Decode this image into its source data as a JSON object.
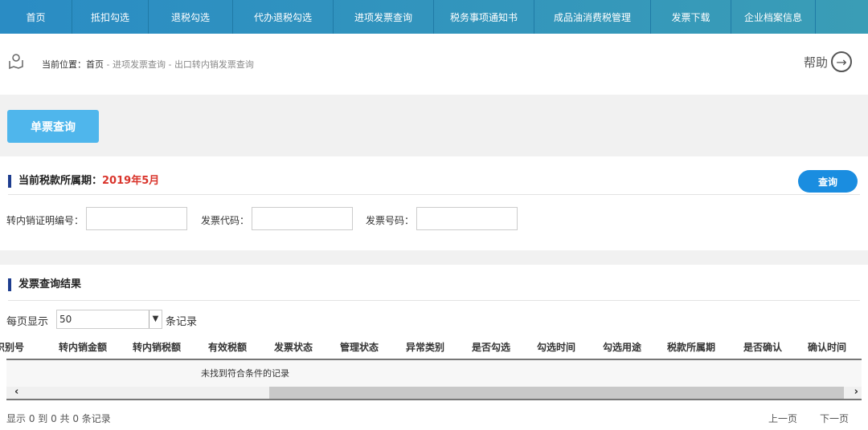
{
  "nav": [
    "首页",
    "抵扣勾选",
    "退税勾选",
    "代办退税勾选",
    "进项发票查询",
    "税务事项通知书",
    "成品油消费税管理",
    "发票下载",
    "企业档案信息"
  ],
  "breadcrumb": {
    "prefix": "当前位置：",
    "home": "首页",
    "sep1": " - ",
    "level1": "进项发票查询",
    "sep2": " - ",
    "current": "出口转内销发票查询"
  },
  "help": {
    "label": "帮助",
    "icon": "→"
  },
  "single_query_button": "单票查询",
  "period": {
    "label": "当前税款所属期：",
    "value": "2019年5月"
  },
  "query_button": "查询",
  "fields": {
    "cert_no": "转内销证明编号：",
    "invoice_code": "发票代码：",
    "invoice_number": "发票号码："
  },
  "results": {
    "title": "发票查询结果",
    "page_size_prefix": "每页显示",
    "page_size": "50",
    "page_size_suffix": "条记录",
    "columns": [
      "识别号",
      "转内销金额",
      "转内销税额",
      "有效税额",
      "发票状态",
      "管理状态",
      "异常类别",
      "是否勾选",
      "勾选时间",
      "勾选用途",
      "税款所属期",
      "是否确认",
      "确认时间"
    ],
    "empty": "未找到符合条件的记录",
    "summary": "显示 0 到 0 共 0 条记录",
    "prev": "上一页",
    "next": "下一页"
  }
}
